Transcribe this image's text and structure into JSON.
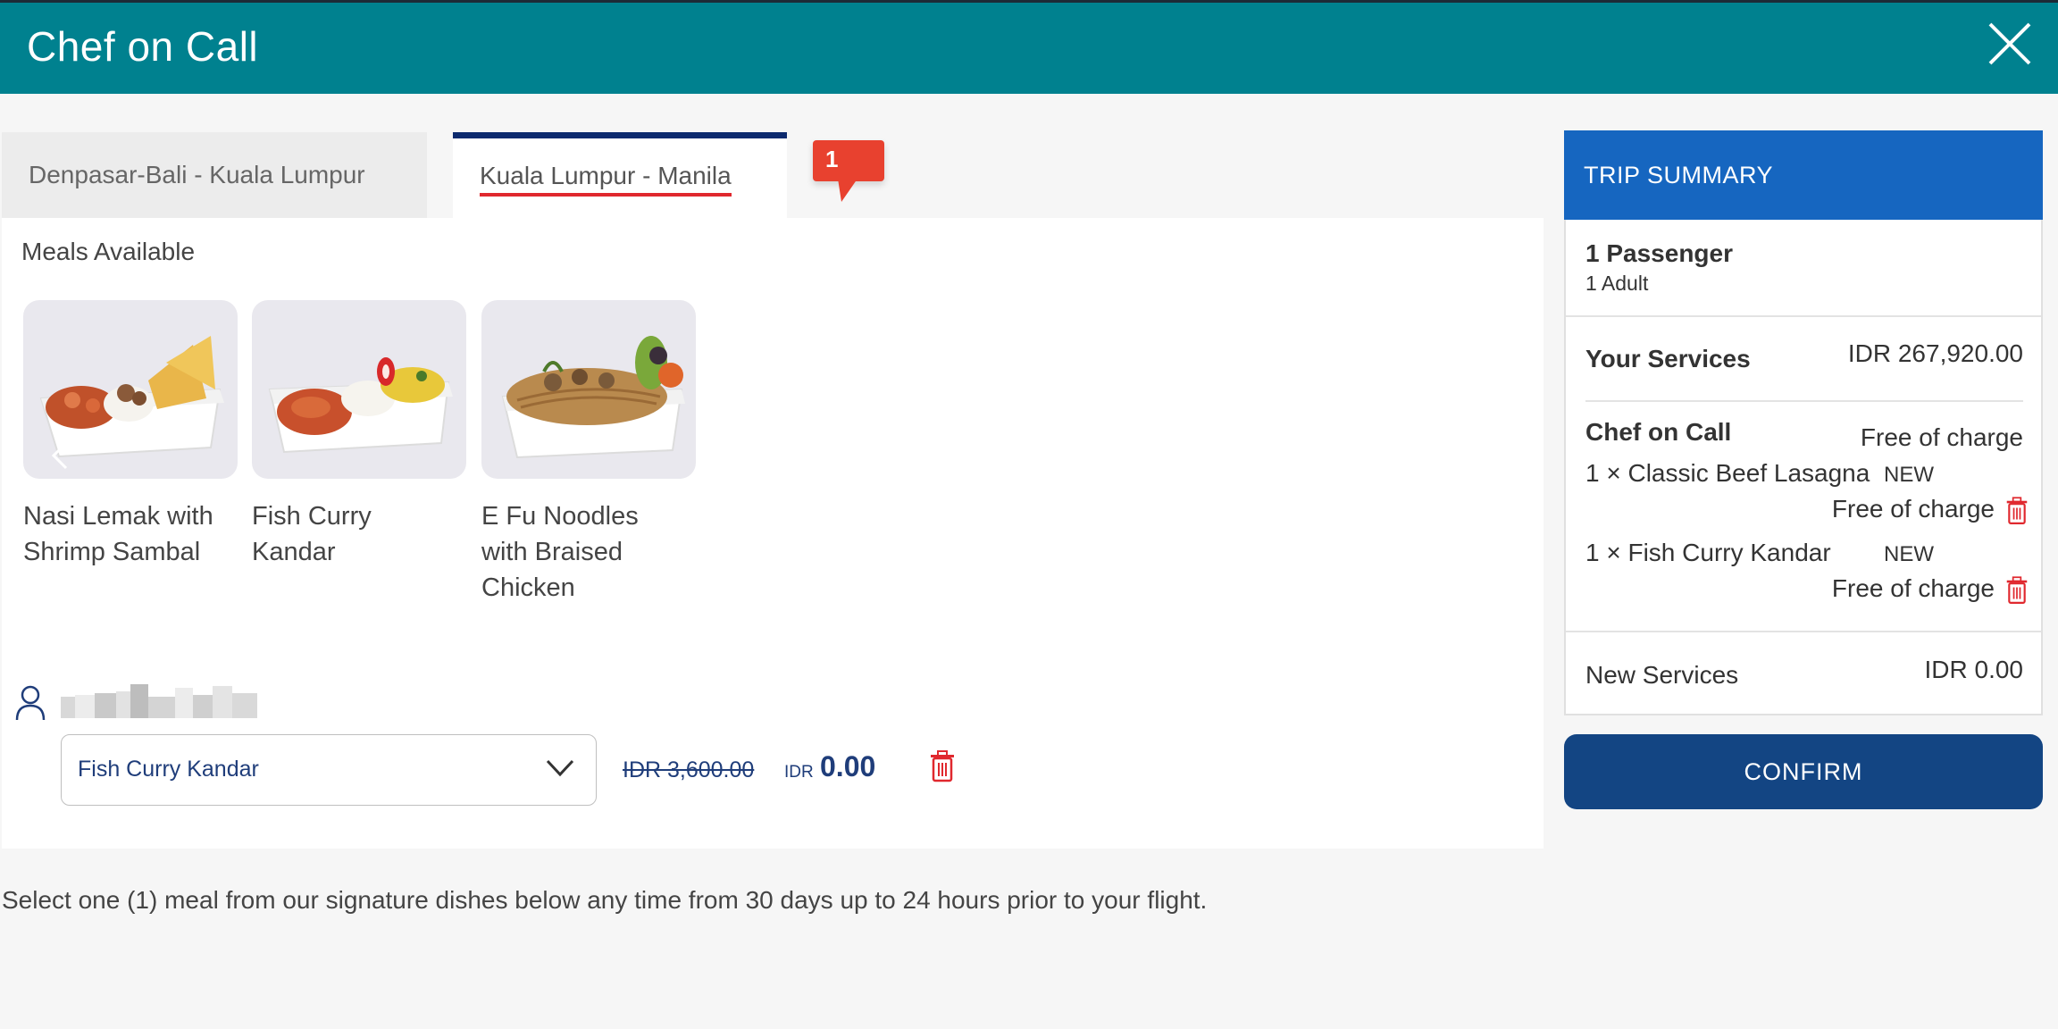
{
  "header": {
    "title": "Chef on Call"
  },
  "tabs": [
    {
      "label": "Denpasar-Bali - Kuala Lumpur"
    },
    {
      "label": "Kuala Lumpur - Manila"
    }
  ],
  "badge": {
    "count": "1"
  },
  "meals": {
    "heading": "Meals Available",
    "items": [
      {
        "name_line1": "Nasi Lemak with",
        "name_line2": "Shrimp Sambal",
        "name_line3": ""
      },
      {
        "name_line1": "Fish Curry",
        "name_line2": "Kandar",
        "name_line3": ""
      },
      {
        "name_line1": "E Fu Noodles",
        "name_line2": "with Braised",
        "name_line3": "Chicken"
      }
    ]
  },
  "passenger_selection": {
    "selected_meal": "Fish Curry Kandar",
    "old_price": "IDR 3,600.00",
    "currency": "IDR",
    "price": "0.00"
  },
  "instruction": "Select one (1) meal from our signature dishes below any time from 30 days up to 24 hours prior to your flight.",
  "trip_summary": {
    "title": "TRIP SUMMARY",
    "passengers": "1 Passenger",
    "passenger_type": "1 Adult",
    "your_services_label": "Your Services",
    "your_services_value": "IDR 267,920.00",
    "chef_label": "Chef on Call",
    "chef_value": "Free of charge",
    "items": [
      {
        "name": "1 × Classic Beef Lasagna",
        "tag": "NEW",
        "price": "Free of charge"
      },
      {
        "name": "1 × Fish Curry Kandar",
        "tag": "NEW",
        "price": "Free of charge"
      }
    ],
    "new_services_label": "New Services",
    "new_services_value": "IDR 0.00"
  },
  "confirm_label": "CONFIRM",
  "colors": {
    "header": "#00818f",
    "summary_header": "#1666c0",
    "confirm": "#134583",
    "badge": "#e8412f",
    "delete": "#e0282e"
  }
}
